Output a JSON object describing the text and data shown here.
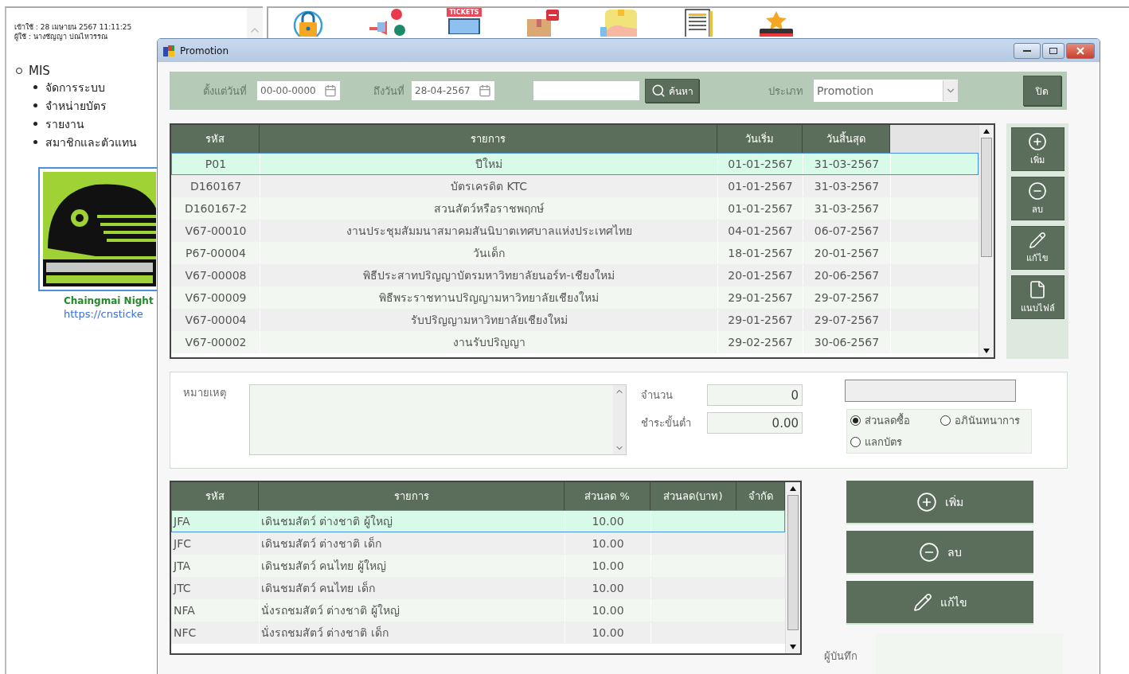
{
  "background_page": {
    "login_time": "เข้าใช้ : 28 เมษายน 2567 11:11:25",
    "user": "ผู้ใช้ : นางชัญญา ปณไหวรรณ",
    "menu": {
      "label": "MIS",
      "children": [
        {
          "label": "จัดการระบบ"
        },
        {
          "label": "จำหน่ายบัตร"
        },
        {
          "label": "รายงาน"
        },
        {
          "label": "สมาชิกและตัวแทน"
        }
      ]
    },
    "caption": "Chaingmai Night",
    "link": "https://cnsticke"
  },
  "toolbar": [
    {
      "kind": "lock"
    },
    {
      "kind": "promo"
    },
    {
      "kind": "tickets",
      "label": "TICKETS"
    },
    {
      "kind": "parcel"
    },
    {
      "kind": "hand"
    },
    {
      "kind": "document"
    },
    {
      "kind": "star"
    }
  ],
  "window": {
    "title": "Promotion"
  },
  "filter": {
    "from_label": "ตั้งแต่วันที่",
    "from_value": "00-00-0000",
    "to_label": "ถึงวันที่",
    "to_value": "28-04-2567",
    "search_button": "ค้นหา",
    "type_label": "ประเภท",
    "type_value": "Promotion",
    "close_button": "ปิด"
  },
  "promotions": {
    "columns": [
      "รหัส",
      "รายการ",
      "วันเริ่ม",
      "วันสิ้นสุด"
    ],
    "rows": [
      {
        "cells": [
          "P01",
          "ปีใหม่",
          "01-01-2567",
          "31-03-2567"
        ],
        "selected": true
      },
      {
        "cells": [
          "D160167",
          "บัตรเครดิต KTC",
          "01-01-2567",
          "31-03-2567"
        ],
        "selected": false
      },
      {
        "cells": [
          "D160167-2",
          "สวนสัตว์หรือราชพฤกษ์",
          "01-01-2567",
          "31-03-2567"
        ],
        "selected": false
      },
      {
        "cells": [
          "V67-00010",
          "งานประชุมสัมมนาสมาคมสันนิบาตเทศบาลแห่งประเทศไทย",
          "04-01-2567",
          "06-07-2567"
        ],
        "selected": false
      },
      {
        "cells": [
          "P67-00004",
          "วันเด็ก",
          "18-01-2567",
          "20-01-2567"
        ],
        "selected": false
      },
      {
        "cells": [
          "V67-00008",
          "พิธีประสาทปริญญาบัตรมหาวิทยาลัยนอร์ท-เชียงใหม่",
          "20-01-2567",
          "20-06-2567"
        ],
        "selected": false
      },
      {
        "cells": [
          "V67-00009",
          "พิธีพระราชทานปริญญามหาวิทยาลัยเชียงใหม่",
          "29-01-2567",
          "29-07-2567"
        ],
        "selected": false
      },
      {
        "cells": [
          "V67-00004",
          "รับปริญญามหาวิทยาลัยเชียงใหม่",
          "29-01-2567",
          "29-07-2567"
        ],
        "selected": false
      },
      {
        "cells": [
          "V67-00002",
          "งานรับปริญญา",
          "29-02-2567",
          "30-06-2567"
        ],
        "selected": false
      }
    ]
  },
  "side_buttons": [
    {
      "kind": "add",
      "label": "เพิ่ม"
    },
    {
      "kind": "remove",
      "label": "ลบ"
    },
    {
      "kind": "edit",
      "label": "แก้ไข"
    },
    {
      "kind": "attach",
      "label": "แนบไฟล์"
    }
  ],
  "details": {
    "note_label": "หมายเหตุ",
    "quantity_label": "จำนวน",
    "quantity_value": "0",
    "min_payment_label": "ชำระขั้นต่ำ",
    "min_payment_value": "0.00",
    "discount_types": [
      {
        "label": "ส่วนลดซื้อ",
        "selected": true
      },
      {
        "label": "อภินันทนาการ",
        "selected": false
      },
      {
        "label": "แลกบัตร",
        "selected": false
      }
    ]
  },
  "items": {
    "columns": [
      "รหัส",
      "รายการ",
      "ส่วนลด %",
      "ส่วนลด(บาท)",
      "จำกัด"
    ],
    "rows": [
      {
        "cells": [
          "JFA",
          "เดินชมสัตว์ ต่างชาติ ผู้ใหญ่",
          "10.00"
        ],
        "selected": true
      },
      {
        "cells": [
          "JFC",
          "เดินชมสัตว์ ต่างชาติ เด็ก",
          "10.00"
        ],
        "selected": false
      },
      {
        "cells": [
          "JTA",
          "เดินชมสัตว์ คนไทย ผู้ใหญ่",
          "10.00"
        ],
        "selected": false
      },
      {
        "cells": [
          "JTC",
          "เดินชมสัตว์ คนไทย เด็ก",
          "10.00"
        ],
        "selected": false
      },
      {
        "cells": [
          "NFA",
          "นั่งรถชมสัตว์ ต่างชาติ ผู้ใหญ่",
          "10.00"
        ],
        "selected": false
      },
      {
        "cells": [
          "NFC",
          "นั่งรถชมสัตว์ ต่างชาติ เด็ก",
          "10.00"
        ],
        "selected": false
      }
    ]
  },
  "item_buttons": [
    {
      "kind": "add",
      "label": "เพิ่ม"
    },
    {
      "kind": "remove",
      "label": "ลบ"
    },
    {
      "kind": "edit",
      "label": "แก้ไข"
    }
  ],
  "recorder_label": "ผู้บันทึก"
}
